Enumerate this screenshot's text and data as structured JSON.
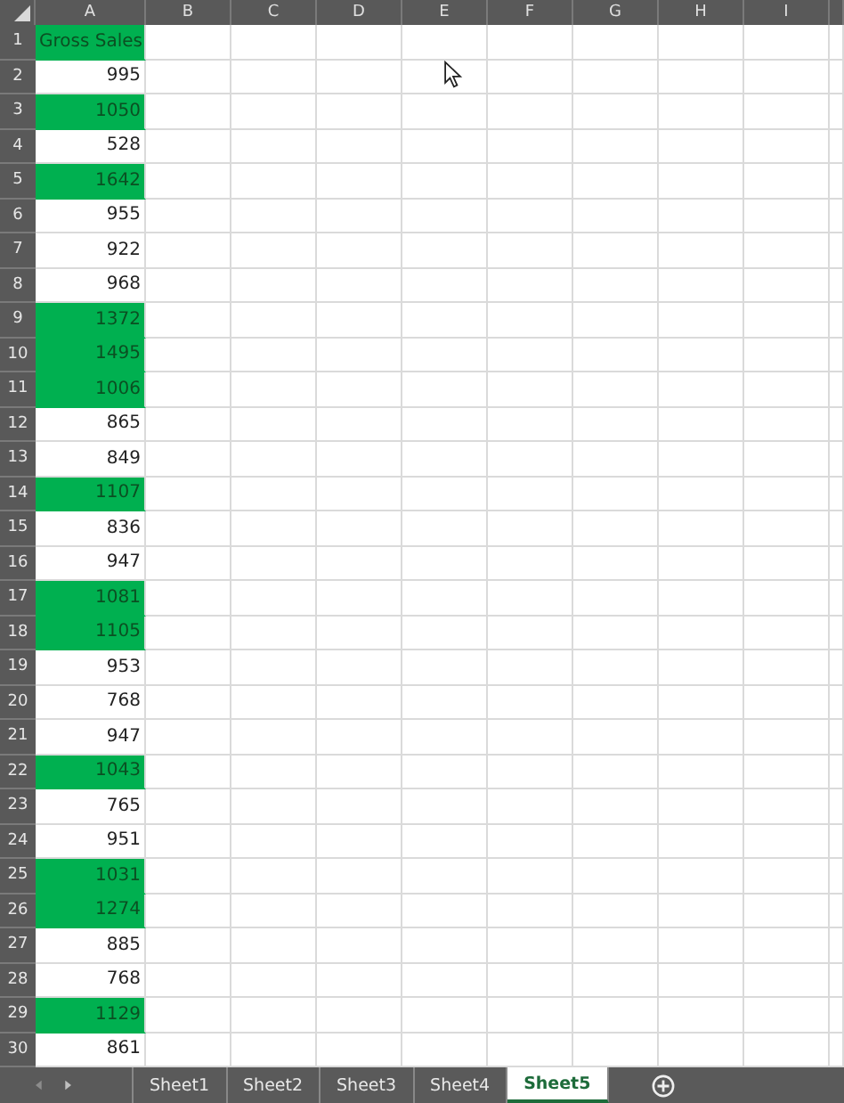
{
  "columns": [
    "A",
    "B",
    "C",
    "D",
    "E",
    "F",
    "G",
    "H",
    "I"
  ],
  "rows": [
    {
      "number": "1",
      "value": "Gross Sales",
      "highlighted": true,
      "kind": "header"
    },
    {
      "number": "2",
      "value": "995",
      "highlighted": false
    },
    {
      "number": "3",
      "value": "1050",
      "highlighted": true
    },
    {
      "number": "4",
      "value": "528",
      "highlighted": false
    },
    {
      "number": "5",
      "value": "1642",
      "highlighted": true
    },
    {
      "number": "6",
      "value": "955",
      "highlighted": false
    },
    {
      "number": "7",
      "value": "922",
      "highlighted": false
    },
    {
      "number": "8",
      "value": "968",
      "highlighted": false
    },
    {
      "number": "9",
      "value": "1372",
      "highlighted": true
    },
    {
      "number": "10",
      "value": "1495",
      "highlighted": true
    },
    {
      "number": "11",
      "value": "1006",
      "highlighted": true
    },
    {
      "number": "12",
      "value": "865",
      "highlighted": false
    },
    {
      "number": "13",
      "value": "849",
      "highlighted": false
    },
    {
      "number": "14",
      "value": "1107",
      "highlighted": true
    },
    {
      "number": "15",
      "value": "836",
      "highlighted": false
    },
    {
      "number": "16",
      "value": "947",
      "highlighted": false
    },
    {
      "number": "17",
      "value": "1081",
      "highlighted": true
    },
    {
      "number": "18",
      "value": "1105",
      "highlighted": true
    },
    {
      "number": "19",
      "value": "953",
      "highlighted": false
    },
    {
      "number": "20",
      "value": "768",
      "highlighted": false
    },
    {
      "number": "21",
      "value": "947",
      "highlighted": false
    },
    {
      "number": "22",
      "value": "1043",
      "highlighted": true
    },
    {
      "number": "23",
      "value": "765",
      "highlighted": false
    },
    {
      "number": "24",
      "value": "951",
      "highlighted": false
    },
    {
      "number": "25",
      "value": "1031",
      "highlighted": true
    },
    {
      "number": "26",
      "value": "1274",
      "highlighted": true
    },
    {
      "number": "27",
      "value": "885",
      "highlighted": false
    },
    {
      "number": "28",
      "value": "768",
      "highlighted": false
    },
    {
      "number": "29",
      "value": "1129",
      "highlighted": true
    },
    {
      "number": "30",
      "value": "861",
      "highlighted": false
    }
  ],
  "sheet_tabs": [
    {
      "label": "Sheet1",
      "selected": false
    },
    {
      "label": "Sheet2",
      "selected": false
    },
    {
      "label": "Sheet3",
      "selected": false
    },
    {
      "label": "Sheet4",
      "selected": false
    },
    {
      "label": "Sheet5",
      "selected": true
    }
  ]
}
